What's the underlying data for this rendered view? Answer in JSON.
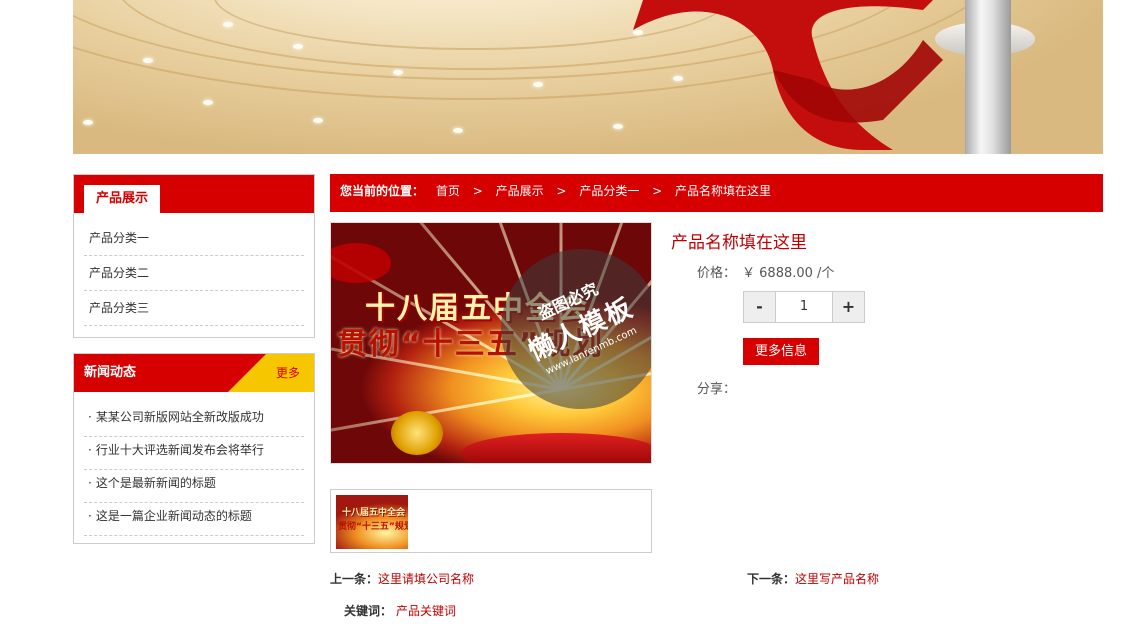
{
  "sidebar": {
    "products_title": "产品展示",
    "categories": [
      "产品分类一",
      "产品分类二",
      "产品分类三"
    ],
    "news_title": "新闻动态",
    "news_more": "更多",
    "news_bullet": "·",
    "news": [
      "某某公司新版网站全新改版成功",
      "行业十大评选新闻发布会将举行",
      "这个是最新新闻的标题",
      "这是一篇企业新闻动态的标题"
    ]
  },
  "breadcrumb": {
    "label": "您当前的位置：",
    "separator": ">",
    "items": [
      "首页",
      "产品展示",
      "产品分类一",
      "产品名称填在这里"
    ]
  },
  "product": {
    "image_text_line1": "十八届五中全会",
    "image_text_line2": "贯彻“十三五”规划",
    "watermark_line1": "盗图必究",
    "watermark_line2": "懒人模板",
    "watermark_line3": "www.lanrenmb.com",
    "thumb_text_line1": "十八届五中全会",
    "thumb_text_line2": "贯彻“十三五”规划",
    "name": "产品名称填在这里",
    "price_label": "价格：",
    "price": "￥ 6888.00 /个",
    "qty_minus": "-",
    "qty_value": "1",
    "qty_plus": "+",
    "more_info_label": "更多信息",
    "share_label": "分享："
  },
  "pager": {
    "prev_label": "上一条：",
    "prev_title": "这里请填公司名称",
    "next_label": "下一条：",
    "next_title": "这里写产品名称",
    "keywords_label": "关键词：",
    "keywords_value": "产品关键词"
  },
  "colors": {
    "accent": "#d70000",
    "more_bg": "#f6c600",
    "link": "#c00000"
  }
}
